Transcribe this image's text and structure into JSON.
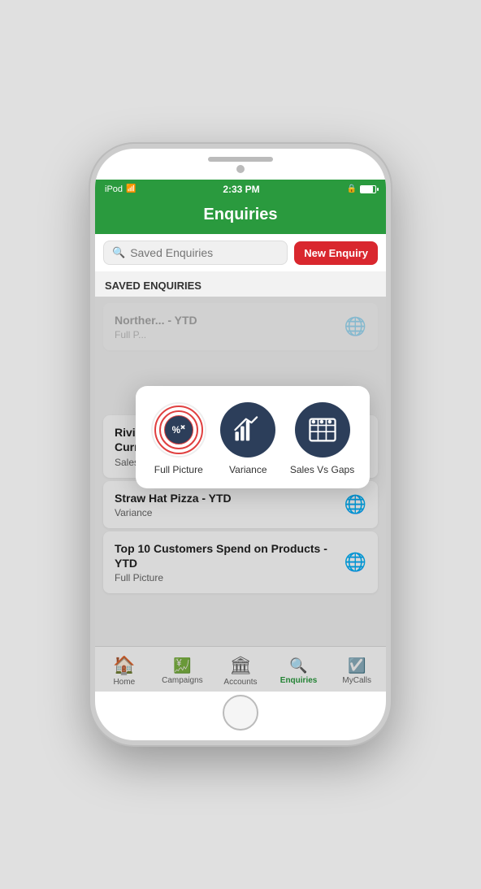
{
  "phone": {
    "status_bar": {
      "device": "iPod",
      "time": "2:33 PM"
    }
  },
  "header": {
    "title": "Enquiries"
  },
  "search": {
    "placeholder": "Saved Enquiries"
  },
  "buttons": {
    "new_enquiry": "New Enquiry"
  },
  "saved_section_label": "SAVED ENQUIRIES",
  "popup": {
    "items": [
      {
        "id": "full-picture",
        "label": "Full Picture"
      },
      {
        "id": "variance",
        "label": "Variance"
      },
      {
        "id": "sales-vs-gaps",
        "label": "Sales Vs Gaps"
      }
    ]
  },
  "list_items": [
    {
      "title": "Norther... - YTD",
      "subtitle": "Full P...",
      "dimmed": true
    },
    {
      "title": "Riviera Autos of Tampa - Products - Current 3 Months",
      "subtitle": "Sales vs. Gaps",
      "dimmed": false
    },
    {
      "title": "Straw Hat Pizza - YTD",
      "subtitle": "Variance",
      "dimmed": false
    },
    {
      "title": "Top 10 Customers Spend on Products - YTD",
      "subtitle": "Full Picture",
      "dimmed": false
    }
  ],
  "bottom_nav": [
    {
      "id": "home",
      "label": "Home",
      "icon": "home"
    },
    {
      "id": "campaigns",
      "label": "Campaigns",
      "icon": "campaigns"
    },
    {
      "id": "accounts",
      "label": "Accounts",
      "icon": "accounts"
    },
    {
      "id": "enquiries",
      "label": "Enquiries",
      "icon": "enquiries",
      "active": true
    },
    {
      "id": "mycalls",
      "label": "MyCalls",
      "icon": "mycalls"
    }
  ]
}
